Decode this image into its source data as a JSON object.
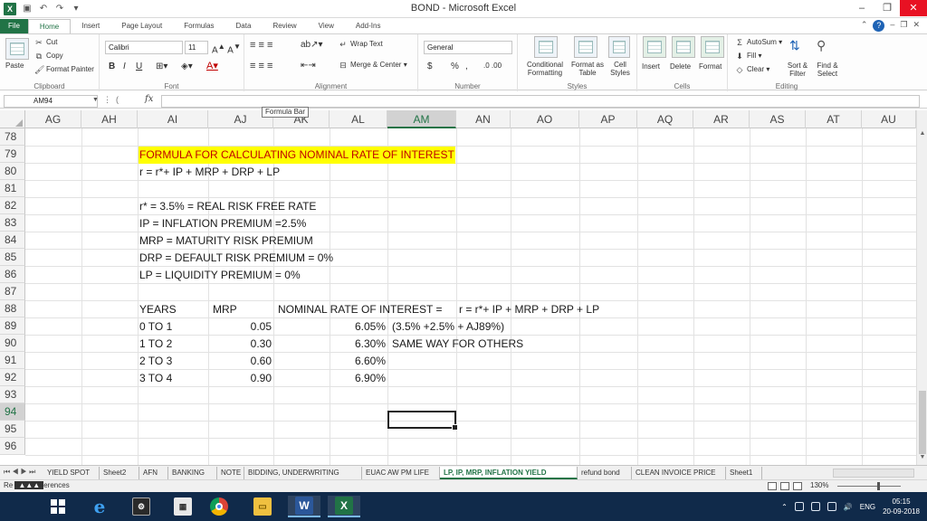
{
  "window": {
    "title": "BOND - Microsoft Excel",
    "minimize": "–",
    "restore": "❐",
    "close": "✕"
  },
  "tabs": [
    "File",
    "Home",
    "Insert",
    "Page Layout",
    "Formulas",
    "Data",
    "Review",
    "View",
    "Add-Ins"
  ],
  "ribbon": {
    "clipboard": {
      "label": "Clipboard",
      "paste": "Paste",
      "cut": "Cut",
      "copy": "Copy",
      "format_painter": "Format Painter"
    },
    "font": {
      "label": "Font",
      "name": "Calibri",
      "size": "11",
      "bold": "B",
      "italic": "I",
      "underline": "U"
    },
    "alignment": {
      "label": "Alignment",
      "wrap": "Wrap Text",
      "merge": "Merge & Center"
    },
    "number": {
      "label": "Number",
      "format": "General",
      "currency": "$",
      "percent": "%",
      "comma": ","
    },
    "styles": {
      "label": "Styles",
      "conditional": "Conditional Formatting",
      "format_table": "Format as Table",
      "cell_styles": "Cell Styles"
    },
    "cells": {
      "label": "Cells",
      "insert": "Insert",
      "delete": "Delete",
      "format": "Format"
    },
    "editing": {
      "label": "Editing",
      "autosum": "AutoSum",
      "fill": "Fill",
      "clear": "Clear",
      "sort": "Sort & Filter",
      "find": "Find & Select"
    }
  },
  "formula_bar": {
    "name_box": "AM94",
    "fx": "fx",
    "value": "",
    "tooltip": "Formula Bar"
  },
  "columns": [
    "AG",
    "AH",
    "AI",
    "AJ",
    "AK",
    "AL",
    "AM",
    "AN",
    "AO",
    "AP",
    "AQ",
    "AR",
    "AS",
    "AT",
    "AU"
  ],
  "selected_column": "AM",
  "rows": [
    "78",
    "79",
    "80",
    "81",
    "82",
    "83",
    "84",
    "85",
    "86",
    "87",
    "88",
    "89",
    "90",
    "91",
    "92",
    "93",
    "94",
    "95",
    "96"
  ],
  "selected_row": "94",
  "cells": {
    "title": "FORMULA FOR CALCULATING NOMINAL RATE OF INTEREST",
    "formula": "r = r*+ IP + MRP + DRP + LP",
    "def_r": "r* = 3.5% = REAL RISK FREE RATE",
    "def_ip": "IP = INFLATION PREMIUM =2.5%",
    "def_mrp": "MRP = MATURITY RISK PREMIUM",
    "def_drp": "DRP = DEFAULT RISK PREMIUM = 0%",
    "def_lp": "LP = LIQUIDITY PREMIUM = 0%",
    "hdr_years": "YEARS",
    "hdr_mrp": "MRP",
    "hdr_nominal": "NOMINAL RATE OF INTEREST =",
    "hdr_formula": "r = r*+ IP + MRP + DRP + LP",
    "table": [
      {
        "years": "0 TO 1",
        "mrp": "0.05",
        "rate": "6.05%",
        "note": "(3.5% +2.5% + AJ89%)"
      },
      {
        "years": "1 TO 2",
        "mrp": "0.30",
        "rate": "6.30%",
        "note": "SAME WAY FOR OTHERS"
      },
      {
        "years": "2 TO 3",
        "mrp": "0.60",
        "rate": "6.60%",
        "note": ""
      },
      {
        "years": "3 TO 4",
        "mrp": "0.90",
        "rate": "6.90%",
        "note": ""
      }
    ]
  },
  "sheet_tabs": [
    "YIELD SPOT",
    "Sheet2",
    "AFN",
    "BANKING",
    "NOTE",
    "BIDDING, UNDERWRITING",
    "EUAC AW PM LIFE",
    "LP, IP, MRP, INFLATION YIELD",
    "refund bond",
    "CLEAN INVOICE PRICE",
    "Sheet1"
  ],
  "active_sheet": "LP, IP, MRP, INFLATION YIELD",
  "status": {
    "left": "Re",
    "left2": "erences",
    "zoom": "130%"
  },
  "taskbar": {
    "lang": "ENG",
    "time": "05:15",
    "date": "20-09-2018"
  },
  "colors": {
    "excel_green": "#217346",
    "highlight": "#ffff00",
    "highlight_text": "#c00000",
    "taskbar": "#102a4a"
  }
}
